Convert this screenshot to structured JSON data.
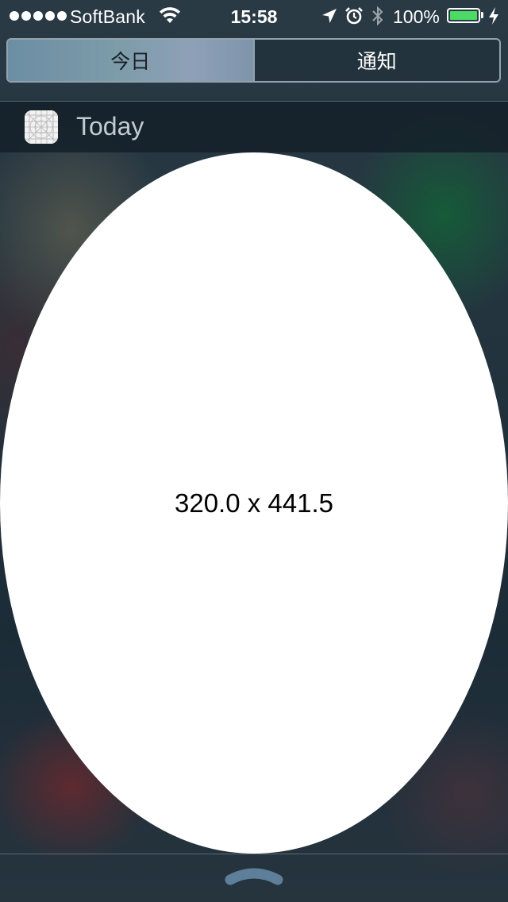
{
  "status_bar": {
    "carrier": "SoftBank",
    "time": "15:58",
    "battery_percent": "100%",
    "signal_bars": 5,
    "icons": [
      "wifi-icon",
      "location-icon",
      "alarm-icon",
      "bluetooth-icon",
      "battery-icon",
      "charging-bolt-icon"
    ],
    "battery_color": "#4cd964"
  },
  "segmented_control": {
    "tabs": [
      {
        "label": "今日",
        "selected": true
      },
      {
        "label": "通知",
        "selected": false
      }
    ]
  },
  "widget": {
    "title": "Today",
    "icon": "app-icon",
    "content_label": "320.0 x 441.5"
  },
  "bottom": {
    "icon": "grabber-chevron-icon"
  }
}
